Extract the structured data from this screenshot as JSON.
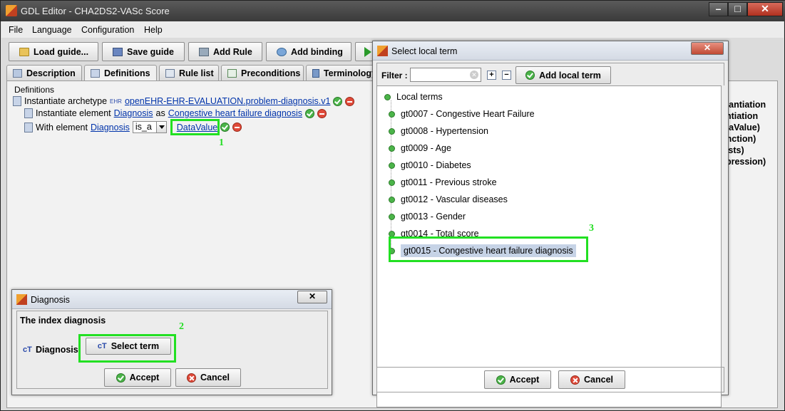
{
  "window": {
    "title": "GDL Editor - CHA2DS2-VASc Score"
  },
  "menu": [
    "File",
    "Language",
    "Configuration",
    "Help"
  ],
  "toolbar": {
    "load_guide": "Load guide...",
    "save_guide": "Save guide",
    "add_rule": "Add Rule",
    "add_binding": "Add binding"
  },
  "tabs": [
    "Description",
    "Definitions",
    "Rule list",
    "Preconditions",
    "Terminology"
  ],
  "definitions": {
    "section_title": "Definitions",
    "line1_prefix": "Instantiate archetype",
    "line1_badge": "EHR",
    "line1_archetype": "openEHR-EHR-EVALUATION.problem-diagnosis.v1",
    "line2_prefix": "Instantiate element",
    "line2_element": "Diagnosis",
    "line2_as": "as",
    "line2_value": "Congestive heart failure diagnosis",
    "line3_prefix": "With element",
    "line3_element": "Diagnosis",
    "line3_operator": "is_a",
    "line3_value": "DataValue"
  },
  "side_panel": [
    "stantiation",
    "antiation",
    "ataValue)",
    "unction)",
    "kists)",
    "xpression)"
  ],
  "markers": {
    "one": "1",
    "two": "2",
    "three": "3"
  },
  "diagnosis_dialog": {
    "title": "Diagnosis",
    "description": "The index diagnosis",
    "field_icon": "cT",
    "field_label": "Diagnosis:",
    "select_term": "Select term",
    "accept": "Accept",
    "cancel": "Cancel"
  },
  "local_term_dialog": {
    "title": "Select local term",
    "filter_label": "Filter :",
    "filter_value": "",
    "add_local_term": "Add local term",
    "root": "Local terms",
    "terms": [
      "gt0007 - Congestive Heart Failure",
      "gt0008 - Hypertension",
      "gt0009 - Age",
      "gt0010 - Diabetes",
      "gt0011 - Previous stroke",
      "gt0012 - Vascular diseases",
      "gt0013 - Gender",
      "gt0014 - Total score",
      "gt0015 - Congestive heart failure diagnosis"
    ],
    "selected_index": 8,
    "accept": "Accept",
    "cancel": "Cancel"
  },
  "colors": {
    "highlight": "#22e022",
    "link": "#0033aa",
    "accept_icon": "#4bb449",
    "cancel_icon": "#e04a3a"
  }
}
